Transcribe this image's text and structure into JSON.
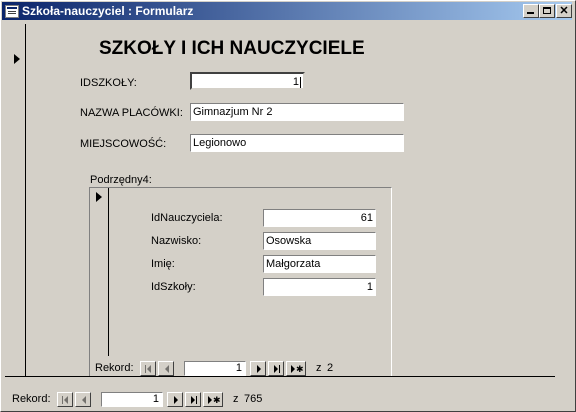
{
  "window": {
    "title": "Szkoła-nauczyciel : Formularz"
  },
  "form": {
    "heading": "SZKOŁY I ICH NAUCZYCIELE",
    "fields": {
      "idszkoly": {
        "label": "IDSZKOŁY:",
        "value": "1"
      },
      "nazwa": {
        "label": "NAZWA PLACÓWKI:",
        "value": "Gimnazjum Nr 2"
      },
      "miejscowosc": {
        "label": "MIEJSCOWOŚĆ:",
        "value": "Legionowo"
      }
    }
  },
  "subform": {
    "label": "Podrzędny4:",
    "fields": {
      "idnauczyciela": {
        "label": "IdNauczyciela:",
        "value": "61"
      },
      "nazwisko": {
        "label": "Nazwisko:",
        "value": "Osowska"
      },
      "imie": {
        "label": "Imię:",
        "value": "Małgorzata"
      },
      "idszkoly": {
        "label": "IdSzkoły:",
        "value": "1"
      }
    },
    "nav": {
      "label": "Rekord:",
      "current": "1",
      "of_label": "z",
      "total": "2"
    }
  },
  "main_nav": {
    "label": "Rekord:",
    "current": "1",
    "of_label": "z",
    "total": "765"
  }
}
